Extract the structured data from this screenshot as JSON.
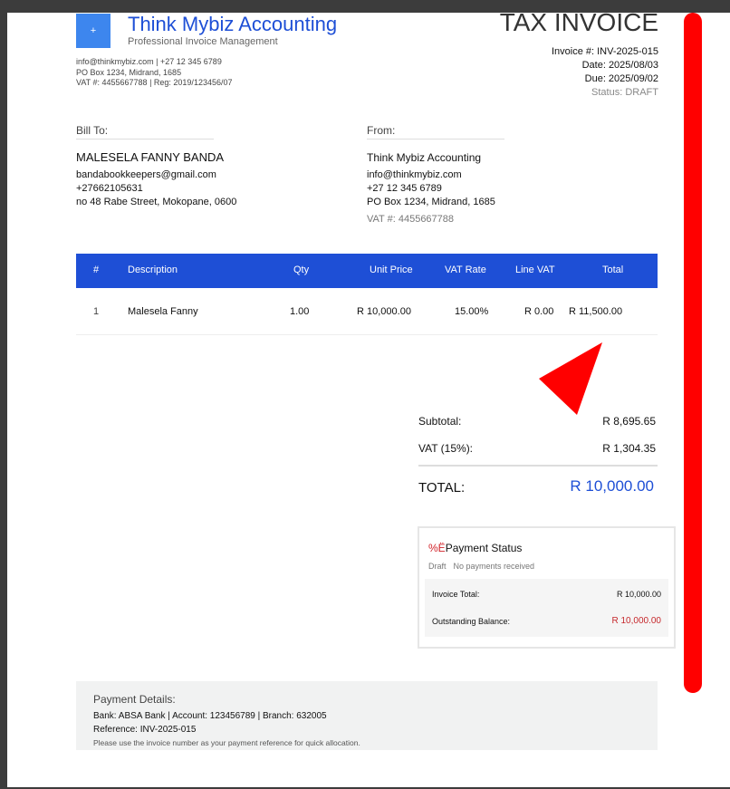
{
  "company": {
    "logo_text": "+",
    "name": "Think Mybiz Accounting",
    "tagline": "Professional Invoice Management",
    "contact_line": "info@thinkmybiz.com | +27 12 345 6789",
    "address_line": "PO Box 1234, Midrand, 1685",
    "reg_line": "VAT #: 4455667788 | Reg: 2019/123456/07"
  },
  "invoice": {
    "title": "TAX INVOICE",
    "number": "Invoice #: INV-2025-015",
    "date": "Date: 2025/08/03",
    "due": "Due: 2025/09/02",
    "status": "Status: DRAFT"
  },
  "bill_to": {
    "label": "Bill To:",
    "name": "MALESELA FANNY BANDA",
    "email": "bandabookkeepers@gmail.com",
    "phone": "+27662105631",
    "address": "no 48 Rabe Street, Mokopane, 0600"
  },
  "from": {
    "label": "From:",
    "name": "Think Mybiz Accounting",
    "email": "info@thinkmybiz.com",
    "phone": "+27 12 345 6789",
    "address": "PO Box 1234, Midrand, 1685",
    "vat": "VAT #: 4455667788"
  },
  "table": {
    "columns": [
      "#",
      "Description",
      "Qty",
      "Unit Price",
      "VAT Rate",
      "Line VAT",
      "Total"
    ],
    "rows": [
      [
        "1",
        "Malesela Fanny",
        "1.00",
        "R 10,000.00",
        "15.00%",
        "R 0.00",
        "R 11,500.00"
      ]
    ]
  },
  "summary": {
    "subtotal_label": "Subtotal:",
    "subtotal_value": "R 8,695.65",
    "vat_label": "VAT (15%):",
    "vat_value": "R 1,304.35",
    "total_label": "TOTAL:",
    "total_value": "R 10,000.00"
  },
  "payment_status": {
    "icon_glyph": "%Ë",
    "title": "Payment Status",
    "state": "Draft",
    "note": "No payments received",
    "invoice_total_label": "Invoice Total:",
    "invoice_total_value": "R 10,000.00",
    "outstanding_label": "Outstanding Balance:",
    "outstanding_value": "R 10,000.00"
  },
  "payment_details": {
    "title": "Payment Details:",
    "bank": "Bank: ABSA Bank | Account: 123456789 | Branch: 632005",
    "reference": "Reference: INV-2025-015",
    "note": "Please use the invoice number as your payment reference for quick allocation."
  },
  "colors": {
    "brand_blue": "#1e4fd6",
    "logo_blue": "#3d86ee",
    "annotation_red": "#ff0000",
    "outstanding_red": "#c6282c"
  }
}
